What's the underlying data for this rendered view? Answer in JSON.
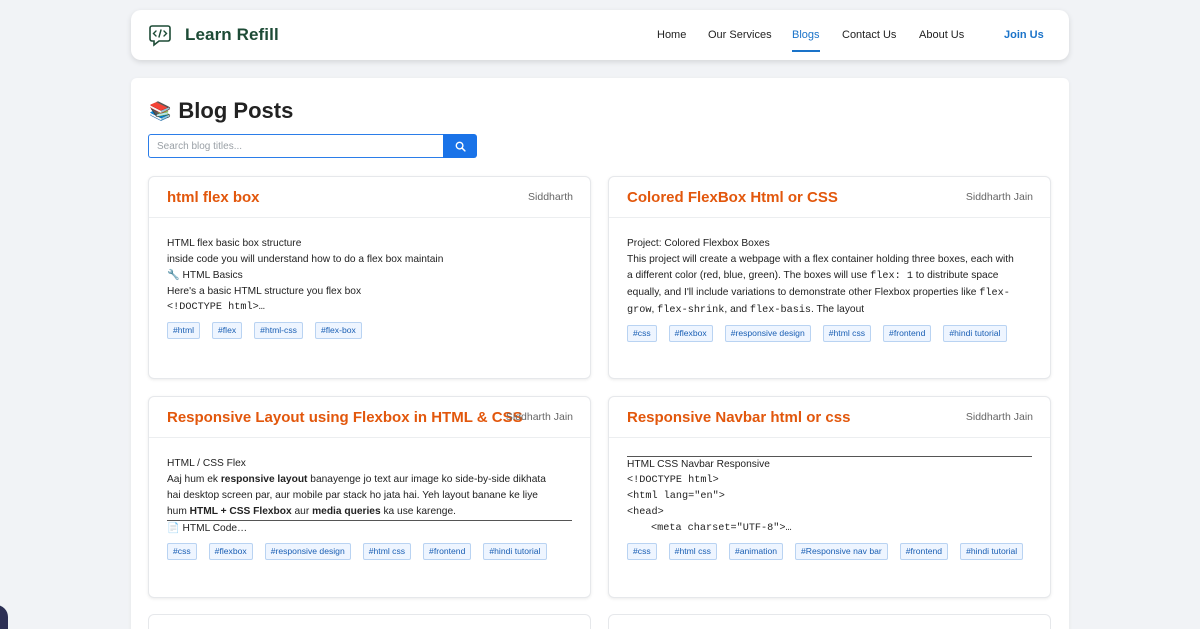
{
  "brand": {
    "name": "Learn Refill",
    "logo_icon": "code-chat-icon",
    "color": "#1d4b36"
  },
  "nav": {
    "items": [
      {
        "label": "Home"
      },
      {
        "label": "Our Services"
      },
      {
        "label": "Blogs"
      },
      {
        "label": "Contact Us"
      },
      {
        "label": "About Us"
      }
    ],
    "active": "Blogs",
    "join_label": "Join Us",
    "accent": "#1a73c9"
  },
  "page": {
    "emoji": "📚",
    "title": "Blog Posts",
    "search_placeholder": "Search blog titles...",
    "search_icon": "search-icon"
  },
  "posts": [
    {
      "title": "html flex box",
      "author": "Siddharth",
      "lines": [
        "HTML flex basic box structure",
        "inside code you will understand how to do a flex box maintain",
        "🔧 HTML Basics",
        "Here's a basic HTML structure you flex box",
        "<!DOCTYPE html>…"
      ],
      "tags": [
        "#html",
        "#flex",
        "#html-css",
        "#flex-box"
      ]
    },
    {
      "title": "Colored FlexBox Html or CSS",
      "author": "Siddharth Jain",
      "lines": [
        "Project: Colored Flexbox Boxes",
        "This project will create a webpage with a flex container holding three boxes, each with",
        "a different color (red, blue, green). The boxes will use",
        "flex: 1",
        "to distribute space",
        "equally, and I'll include variations to demonstrate other Flexbox properties like",
        "flex-",
        "grow",
        "flex-shrink",
        "and",
        "flex-basis",
        ". The layout"
      ],
      "tags": [
        "#css",
        "#flexbox",
        "#responsive design",
        "#html css",
        "#frontend",
        "#hindi tutorial"
      ]
    },
    {
      "title": "Responsive Layout using Flexbox in HTML & CSS",
      "author": "Siddharth Jain",
      "lines": [
        "HTML / CSS Flex",
        "Aaj hum ek",
        "responsive layout",
        "banayenge jo text aur image ko side-by-side dikhata",
        "hai desktop screen par, aur mobile par stack ho jata hai. Yeh layout banane ke liye",
        "hum",
        "HTML + CSS Flexbox",
        "aur",
        "media queries",
        "ka use karenge.",
        "📄 HTML Code…"
      ],
      "tags": [
        "#css",
        "#flexbox",
        "#responsive design",
        "#html css",
        "#frontend",
        "#hindi tutorial"
      ]
    },
    {
      "title": "Responsive Navbar html or css",
      "author": "Siddharth Jain",
      "lines": [
        "HTML CSS Navbar Responsive",
        "<!DOCTYPE html>",
        "<html lang=\"en\">",
        "<head>",
        "<meta charset=\"UTF-8\">…"
      ],
      "tags": [
        "#css",
        "#html css",
        "#animation",
        "#Responsive nav bar",
        "#frontend",
        "#hindi tutorial"
      ]
    }
  ],
  "colors": {
    "title_orange": "#e2570c",
    "tag_blue": "#1a5fb4",
    "search_blue": "#1a73e8"
  }
}
